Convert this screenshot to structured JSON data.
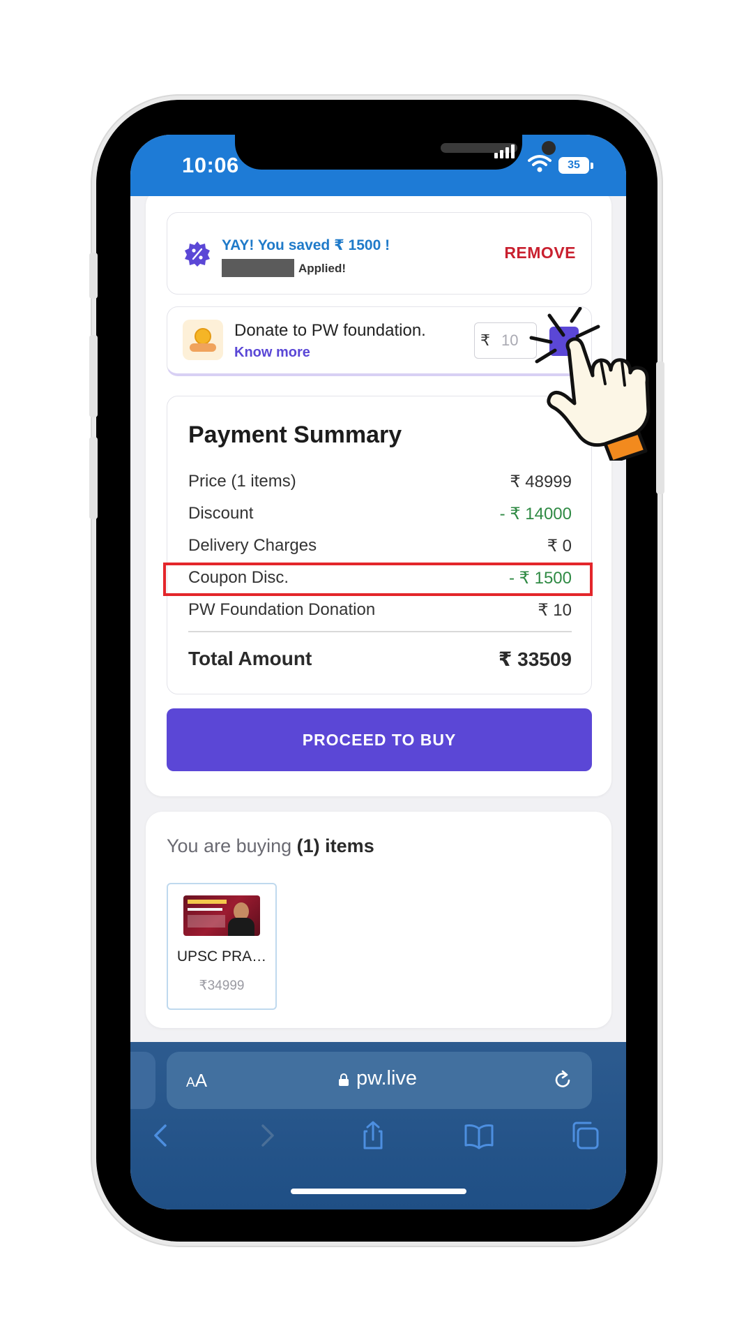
{
  "status_bar": {
    "time": "10:06",
    "battery": "35"
  },
  "coupon": {
    "saved_text": "YAY! You saved ₹ 1500 !",
    "applied_text": "Applied!",
    "remove_label": "REMOVE"
  },
  "donation": {
    "title": "Donate to PW foundation.",
    "link": "Know more",
    "currency": "₹",
    "amount": "10"
  },
  "summary": {
    "title": "Payment Summary",
    "rows": [
      {
        "label": "Price (1 items)",
        "amount": "₹ 48999"
      },
      {
        "label": "Discount",
        "amount": "- ₹ 14000"
      },
      {
        "label": "Delivery Charges",
        "amount": "₹ 0"
      },
      {
        "label": "Coupon Disc.",
        "amount": "- ₹ 1500"
      },
      {
        "label": "PW Foundation Donation",
        "amount": "₹ 10"
      }
    ],
    "total_label": "Total Amount",
    "total_amount": "₹ 33509",
    "discount_color": "#2f8a44",
    "highlight_color": "#e3262b"
  },
  "proceed_label": "PROCEED TO BUY",
  "items": {
    "head_prefix": "You are buying",
    "head_count": "(1) items",
    "list": [
      {
        "name": "UPSC PRA…",
        "price": "₹34999"
      }
    ]
  },
  "browser": {
    "text_size": "AA",
    "url": "pw.live"
  },
  "colors": {
    "primary": "#5b47d6",
    "status_bar": "#1e7bd6",
    "remove": "#c9202f"
  }
}
